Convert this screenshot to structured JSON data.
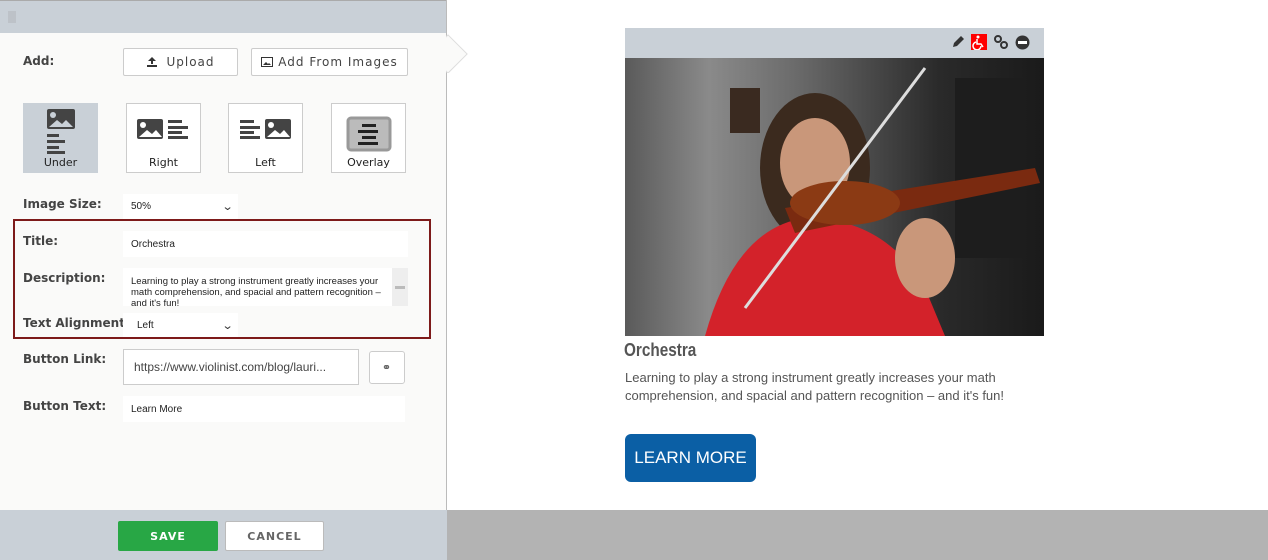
{
  "editor": {
    "add_label": "Add:",
    "upload_label": "Upload",
    "add_from_images_label": "Add From Images",
    "layouts": [
      {
        "label": "Under",
        "selected": true
      },
      {
        "label": "Right"
      },
      {
        "label": "Left"
      },
      {
        "label": "Overlay"
      }
    ],
    "image_size_label": "Image Size:",
    "image_size_value": "50%",
    "title_label": "Title:",
    "title_value": "Orchestra",
    "description_label": "Description:",
    "description_value": "Learning to play a strong instrument greatly increases your math comprehension, and spacial and pattern recognition – and it's fun!",
    "text_alignment_label": "Text Alignment:",
    "text_alignment_value": "Left",
    "button_link_label": "Button Link:",
    "button_link_value": "https://www.violinist.com/blog/lauri...",
    "button_text_label": "Button Text:",
    "button_text_value": "Learn More",
    "save_label": "SAVE",
    "cancel_label": "CANCEL",
    "highlight_color": "#7d1a1a"
  },
  "preview": {
    "tools": [
      "pencil-icon",
      "accessibility-icon",
      "link-icon",
      "remove-icon"
    ],
    "title": "Orchestra",
    "description": "Learning to play a strong instrument greatly increases your math comprehension, and spacial and pattern recognition – and it's fun!",
    "button_label": "LEARN MORE",
    "button_color": "#0b5fa5"
  }
}
